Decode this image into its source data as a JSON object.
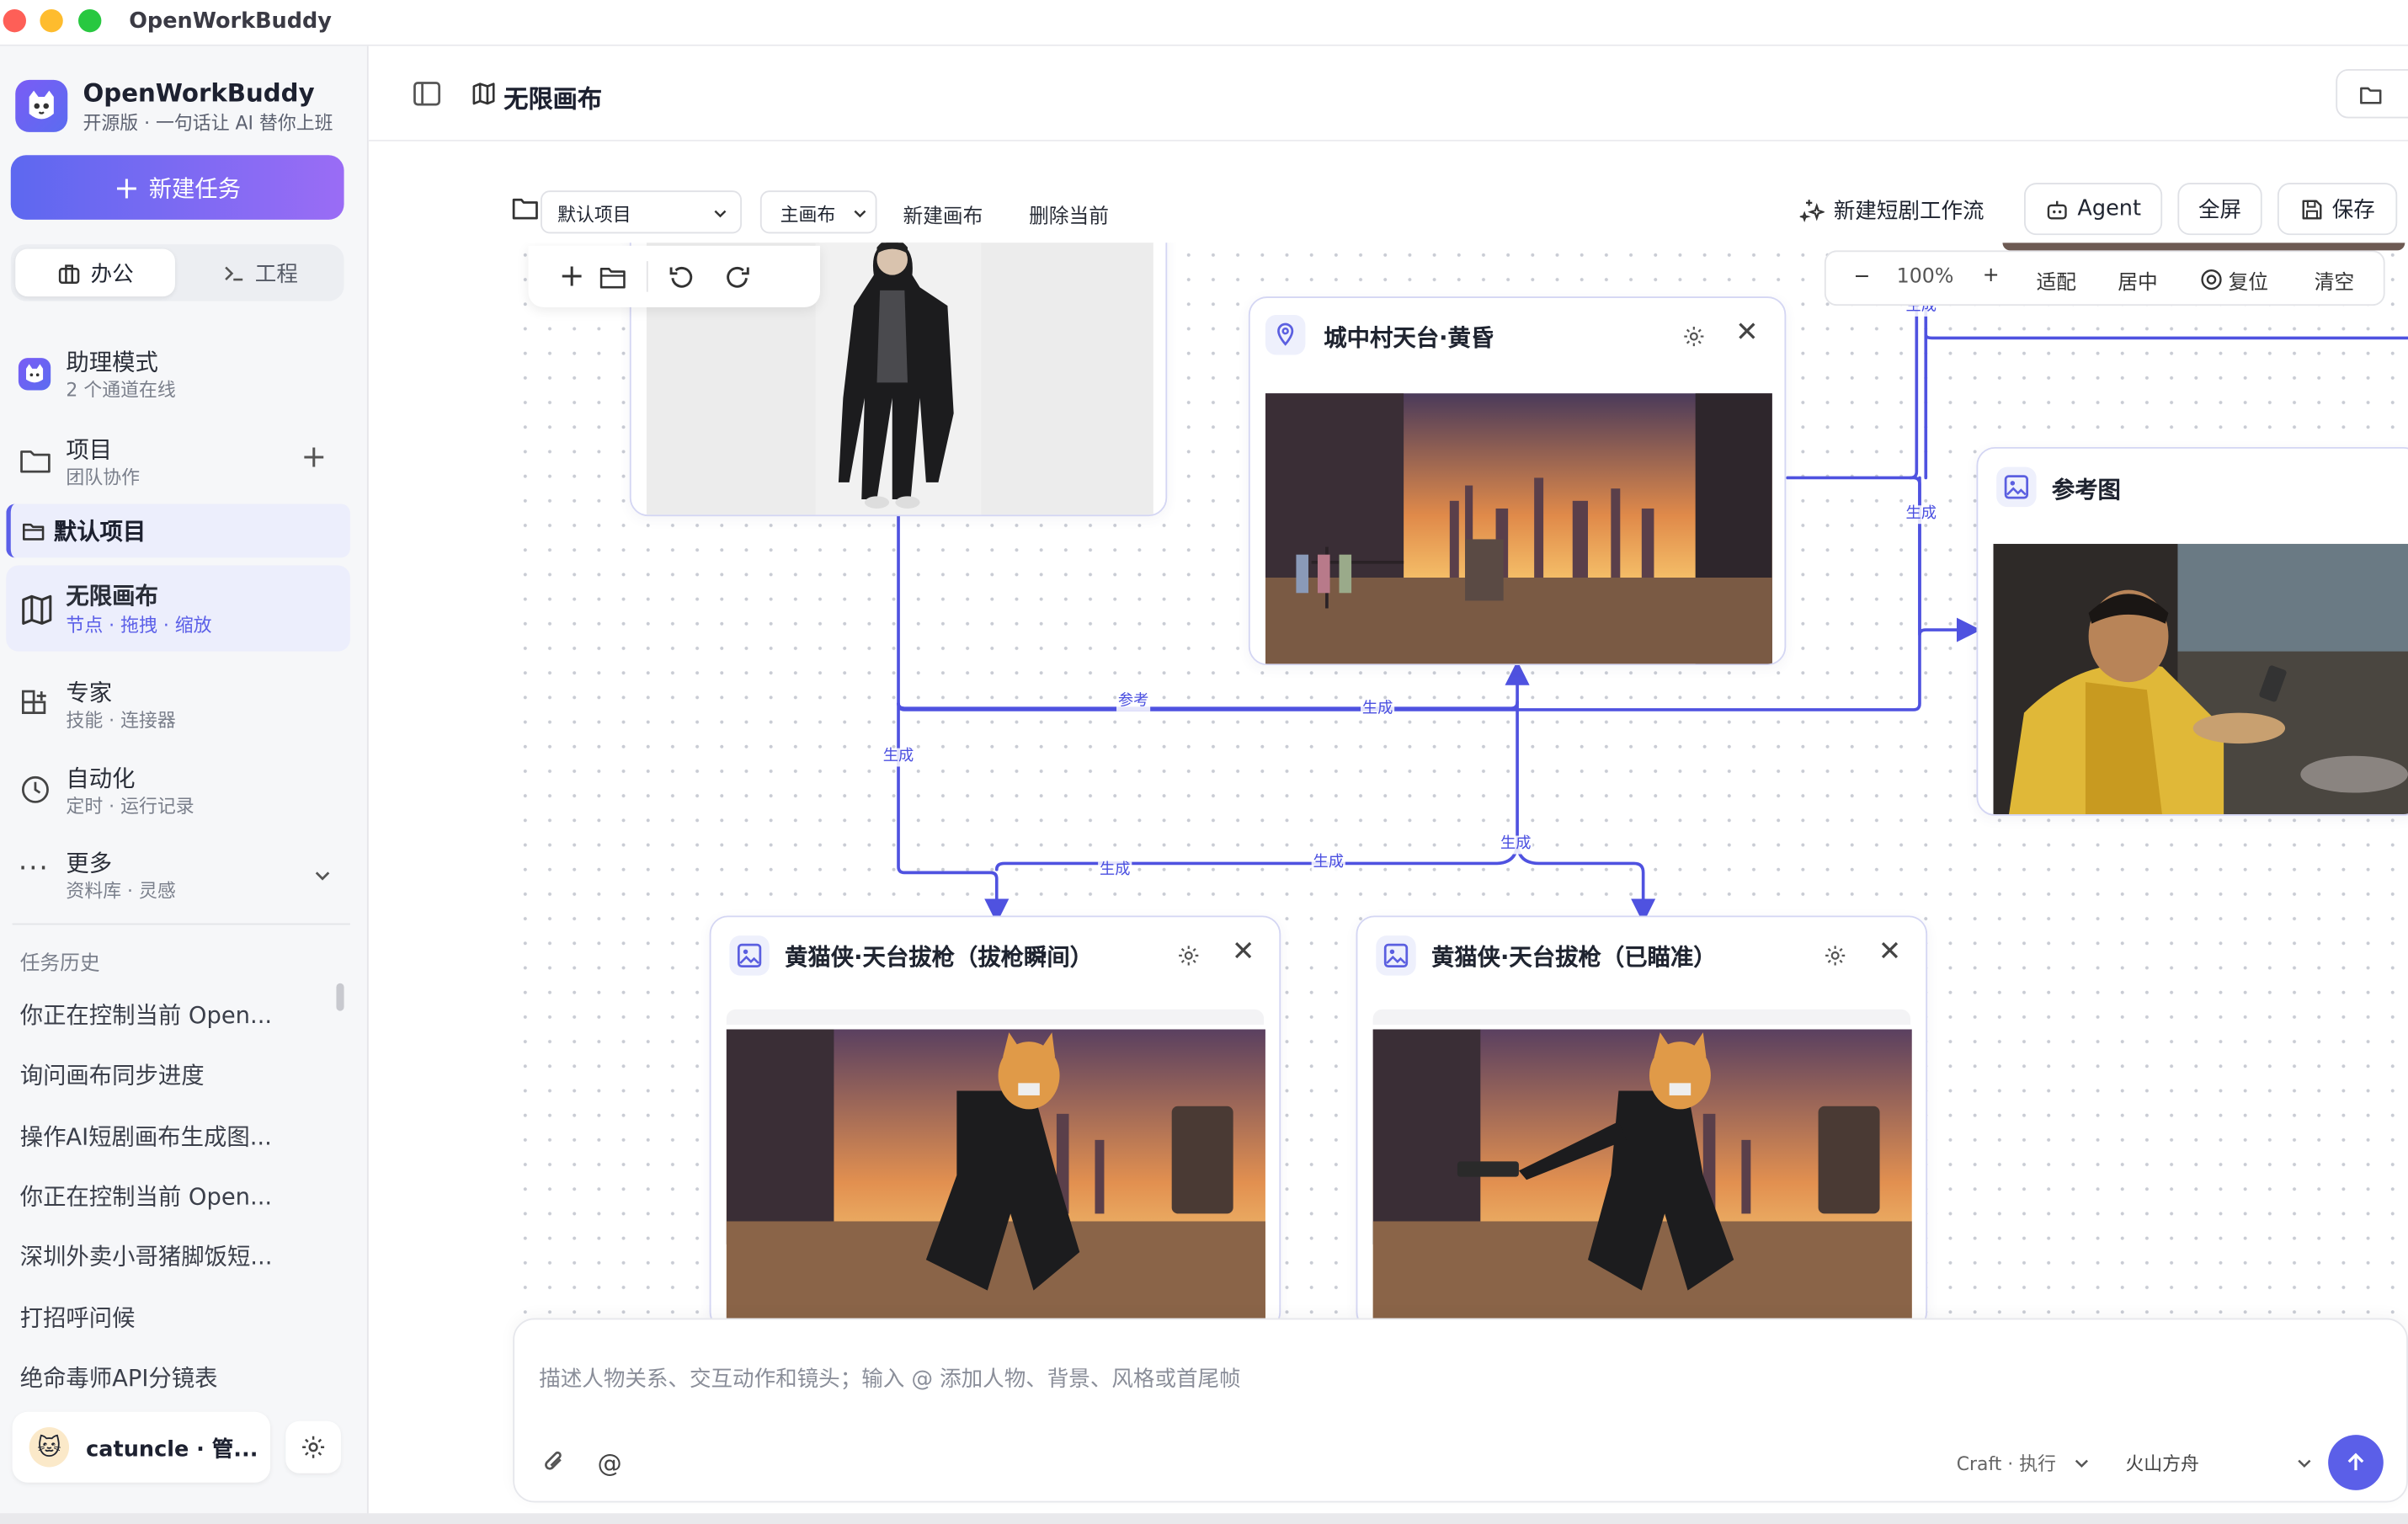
{
  "window": {
    "title": "OpenWorkBuddy"
  },
  "sidebar": {
    "brand": {
      "name": "OpenWorkBuddy",
      "tagline": "开源版 · 一句话让 AI 替你上班"
    },
    "new_task_label": "新建任务",
    "mode_tabs": [
      {
        "label": "办公",
        "active": true
      },
      {
        "label": "工程",
        "active": false
      }
    ],
    "nav": [
      {
        "title": "助理模式",
        "sub": "2 个通道在线"
      },
      {
        "title": "项目",
        "sub": "团队协作"
      },
      {
        "title": "默认项目"
      },
      {
        "title": "无限画布",
        "sub": "节点 · 拖拽 · 缩放",
        "active": true
      },
      {
        "title": "专家",
        "sub": "技能 · 连接器"
      },
      {
        "title": "自动化",
        "sub": "定时 · 运行记录"
      },
      {
        "title": "更多",
        "sub": "资料库 · 灵感"
      }
    ],
    "history_title": "任务历史",
    "history": [
      "你正在控制当前 Open...",
      "询问画布同步进度",
      "操作AI短剧画布生成图...",
      "你正在控制当前 Open...",
      "深圳外卖小哥猪脚饭短...",
      "打招呼问候",
      "绝命毒师API分镜表"
    ],
    "user": {
      "name": "catuncle · 管..."
    }
  },
  "header": {
    "title": "无限画布"
  },
  "toolbar": {
    "project_select": "默认项目",
    "canvas_select": "主画布",
    "new_canvas": "新建画布",
    "delete_current": "删除当前",
    "new_workflow": "新建短剧工作流",
    "agent": "Agent",
    "fullscreen": "全屏",
    "save": "保存"
  },
  "zoom_bar": {
    "minus": "−",
    "level": "100%",
    "plus": "+",
    "fit": "适配",
    "center": "居中",
    "reset": "复位",
    "clear": "清空"
  },
  "nodes": [
    {
      "title": "城中村天台·黄昏",
      "icon": "location-pin-icon"
    },
    {
      "title": "参考图",
      "icon": "image-icon"
    },
    {
      "title": "黄猫侠·天台拔枪（拔枪瞬间）",
      "icon": "image-icon"
    },
    {
      "title": "黄猫侠·天台拔枪（已瞄准）",
      "icon": "image-icon"
    }
  ],
  "edges": {
    "ref": "参考",
    "gen": "生成"
  },
  "composer": {
    "placeholder": "描述人物关系、交互动作和镜头；输入 @ 添加人物、背景、风格或首尾帧",
    "mode": "Craft · 执行",
    "model": "火山方舟"
  },
  "colors": {
    "accent": "#5b5fe8",
    "edge": "#4f52e0",
    "active_bg": "#eceefc"
  }
}
